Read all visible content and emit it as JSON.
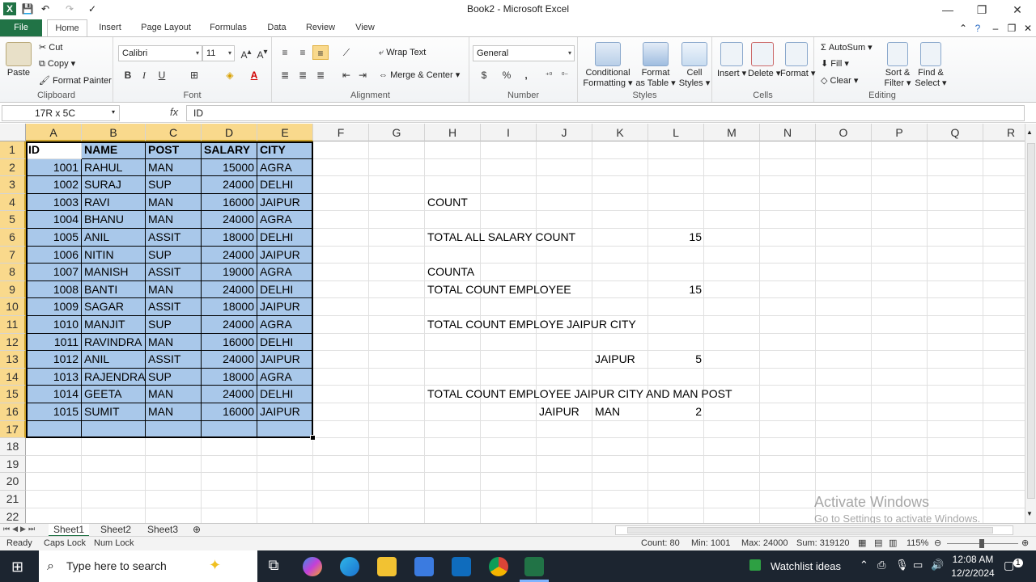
{
  "window": {
    "title": "Book2  -  Microsoft Excel",
    "app_icon_letter": "X"
  },
  "tabs": [
    "File",
    "Home",
    "Insert",
    "Page Layout",
    "Formulas",
    "Data",
    "Review",
    "View"
  ],
  "ribbon": {
    "clipboard": {
      "paste": "Paste",
      "cut": "Cut",
      "copy": "Copy",
      "format_painter": "Format Painter",
      "label": "Clipboard"
    },
    "font": {
      "name": "Calibri",
      "size": "11",
      "bold": "B",
      "italic": "I",
      "underline": "U",
      "label": "Font"
    },
    "alignment": {
      "wrap_text": "Wrap Text",
      "merge_center": "Merge & Center",
      "label": "Alignment"
    },
    "number": {
      "format": "General",
      "currency": "$",
      "percent": "%",
      "comma": ",",
      "label": "Number"
    },
    "styles": {
      "conditional_1": "Conditional",
      "conditional_2": "Formatting",
      "format_table_1": "Format",
      "format_table_2": "as Table",
      "cell_styles_1": "Cell",
      "cell_styles_2": "Styles",
      "label": "Styles"
    },
    "cells": {
      "insert": "Insert",
      "delete": "Delete",
      "format": "Format",
      "label": "Cells"
    },
    "editing": {
      "autosum": "AutoSum",
      "fill": "Fill",
      "clear": "Clear",
      "sort_1": "Sort &",
      "sort_2": "Filter",
      "find_1": "Find &",
      "find_2": "Select",
      "label": "Editing"
    }
  },
  "formula_bar": {
    "name_box": "17R x 5C",
    "fx": "fx",
    "content": "ID"
  },
  "columns": [
    "A",
    "B",
    "C",
    "D",
    "E",
    "F",
    "G",
    "H",
    "I",
    "J",
    "K",
    "L",
    "M",
    "N",
    "O",
    "P",
    "Q",
    "R"
  ],
  "rows": [
    "1",
    "2",
    "3",
    "4",
    "5",
    "6",
    "7",
    "8",
    "9",
    "10",
    "11",
    "12",
    "13",
    "14",
    "15",
    "16",
    "17",
    "18",
    "19",
    "20",
    "21",
    "22"
  ],
  "table": {
    "headers": [
      "ID",
      "NAME",
      "POST",
      "SALARY",
      "CITY"
    ],
    "rows": [
      [
        "1001",
        "RAHUL",
        "MAN",
        "15000",
        "AGRA"
      ],
      [
        "1002",
        "SURAJ",
        "SUP",
        "24000",
        "DELHI"
      ],
      [
        "1003",
        "RAVI",
        "MAN",
        "16000",
        "JAIPUR"
      ],
      [
        "1004",
        "BHANU",
        "MAN",
        "24000",
        "AGRA"
      ],
      [
        "1005",
        "ANIL",
        "ASSIT",
        "18000",
        "DELHI"
      ],
      [
        "1006",
        "NITIN",
        "SUP",
        "24000",
        "JAIPUR"
      ],
      [
        "1007",
        "MANISH",
        "ASSIT",
        "19000",
        "AGRA"
      ],
      [
        "1008",
        "BANTI",
        "MAN",
        "24000",
        "DELHI"
      ],
      [
        "1009",
        "SAGAR",
        "ASSIT",
        "18000",
        "JAIPUR"
      ],
      [
        "1010",
        "MANJIT",
        "SUP",
        "24000",
        "AGRA"
      ],
      [
        "1011",
        "RAVINDRA",
        "MAN",
        "16000",
        "DELHI"
      ],
      [
        "1012",
        "ANIL",
        "ASSIT",
        "24000",
        "JAIPUR"
      ],
      [
        "1013",
        "RAJENDRA",
        "SUP",
        "18000",
        "AGRA"
      ],
      [
        "1014",
        "GEETA",
        "MAN",
        "24000",
        "DELHI"
      ],
      [
        "1015",
        "SUMIT",
        "MAN",
        "16000",
        "JAIPUR"
      ]
    ]
  },
  "notes": {
    "count": "COUNT",
    "total_salary_label": "TOTAL ALL SALARY COUNT",
    "total_salary_value": "15",
    "counta": "COUNTA",
    "total_emp_label": "TOTAL COUNT EMPLOYEE",
    "total_emp_value": "15",
    "jaipur_title": "TOTAL COUNT EMPLOYE JAIPUR CITY",
    "jaipur_city": "JAIPUR",
    "jaipur_value": "5",
    "jaipur_man_title": "TOTAL COUNT EMPLOYEE JAIPUR CITY AND MAN POST",
    "jm_city": "JAIPUR",
    "jm_post": "MAN",
    "jm_value": "2"
  },
  "sheets": [
    "Sheet1",
    "Sheet2",
    "Sheet3"
  ],
  "status": {
    "ready": "Ready",
    "caps": "Caps Lock",
    "num": "Num Lock",
    "count": "Count: 80",
    "min": "Min: 1001",
    "max": "Max: 24000",
    "sum": "Sum: 319120",
    "zoom": "115%"
  },
  "watermark": {
    "line1": "Activate Windows",
    "line2": "Go to Settings to activate Windows."
  },
  "taskbar": {
    "search_placeholder": "Type here to search",
    "watchlist": "Watchlist ideas",
    "time": "12:08 AM",
    "date": "12/2/2024",
    "notification_count": "1"
  },
  "colors": {
    "excel_green": "#217346",
    "selection": "#a9c8ea",
    "header_sel": "#f9d98c"
  }
}
